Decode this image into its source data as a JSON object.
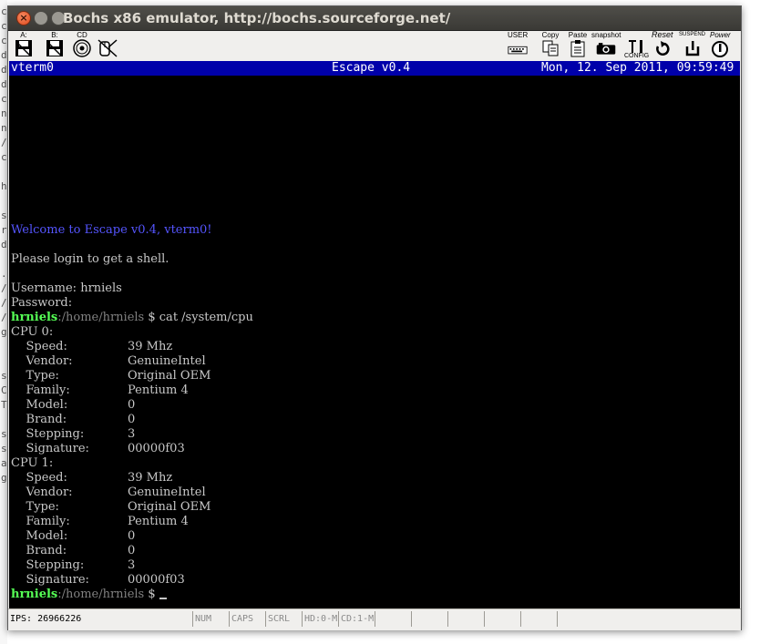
{
  "window": {
    "title": "Bochs x86 emulator, http://bochs.sourceforge.net/"
  },
  "toolbar": {
    "floppy_a_label": "A:",
    "floppy_b_label": "B:",
    "cdrom_label": "CD",
    "user_label": "USER",
    "copy_label": "Copy",
    "paste_label": "Paste",
    "snapshot_label": "snapshot",
    "config_label": "CONFIG",
    "reset_label": "Reset",
    "suspend_label": "SUSPEND",
    "power_label": "Power"
  },
  "vterm": {
    "name": "vterm0",
    "title": "Escape v0.4",
    "datetime": "Mon, 12. Sep 2011, 09:59:49"
  },
  "terminal": {
    "welcome": "Welcome to Escape v0.4, vterm0!",
    "login_prompt": "Please login to get a shell.",
    "username_line": "Username: hrniels",
    "password_line": "Password:",
    "prompt_user": "hrniels",
    "prompt_path": ":/home/hrniels",
    "prompt_symbol": " $ ",
    "command": "cat /system/cpu",
    "cpus": [
      {
        "header": "CPU 0:",
        "fields": [
          {
            "key": "    Speed:",
            "value": "39 Mhz"
          },
          {
            "key": "    Vendor:",
            "value": "GenuineIntel"
          },
          {
            "key": "    Type:",
            "value": "Original OEM"
          },
          {
            "key": "    Family:",
            "value": "Pentium 4"
          },
          {
            "key": "    Model:",
            "value": "0"
          },
          {
            "key": "    Brand:",
            "value": "0"
          },
          {
            "key": "    Stepping:",
            "value": "3"
          },
          {
            "key": "    Signature:",
            "value": "00000f03"
          }
        ]
      },
      {
        "header": "CPU 1:",
        "fields": [
          {
            "key": "    Speed:",
            "value": "39 Mhz"
          },
          {
            "key": "    Vendor:",
            "value": "GenuineIntel"
          },
          {
            "key": "    Type:",
            "value": "Original OEM"
          },
          {
            "key": "    Family:",
            "value": "Pentium 4"
          },
          {
            "key": "    Model:",
            "value": "0"
          },
          {
            "key": "    Brand:",
            "value": "0"
          },
          {
            "key": "    Stepping:",
            "value": "3"
          },
          {
            "key": "    Signature:",
            "value": "00000f03"
          }
        ]
      }
    ]
  },
  "statusbar": {
    "ips": "IPS:  26966226",
    "num": "NUM",
    "caps": "CAPS",
    "scrl": "SCRL",
    "hd": "HD:0-M",
    "cd": "CD:1-M"
  },
  "colors": {
    "vterm_bar": "#0000aa",
    "welcome": "#5555ff",
    "prompt_user": "#55ff55",
    "prompt_path": "#808080",
    "terminal_text": "#c8c8c8",
    "close_button": "#e0491c"
  },
  "edge_chars": [
    "c",
    "c",
    "c",
    "d",
    "d",
    "d",
    "c",
    "n",
    "n",
    "/",
    "c",
    "",
    "h",
    "",
    "s",
    "r",
    "d",
    "",
    ".",
    "/",
    "/",
    "/",
    "g",
    "",
    "",
    "s",
    "C",
    "T",
    "",
    "s",
    "s",
    "a",
    "g"
  ]
}
